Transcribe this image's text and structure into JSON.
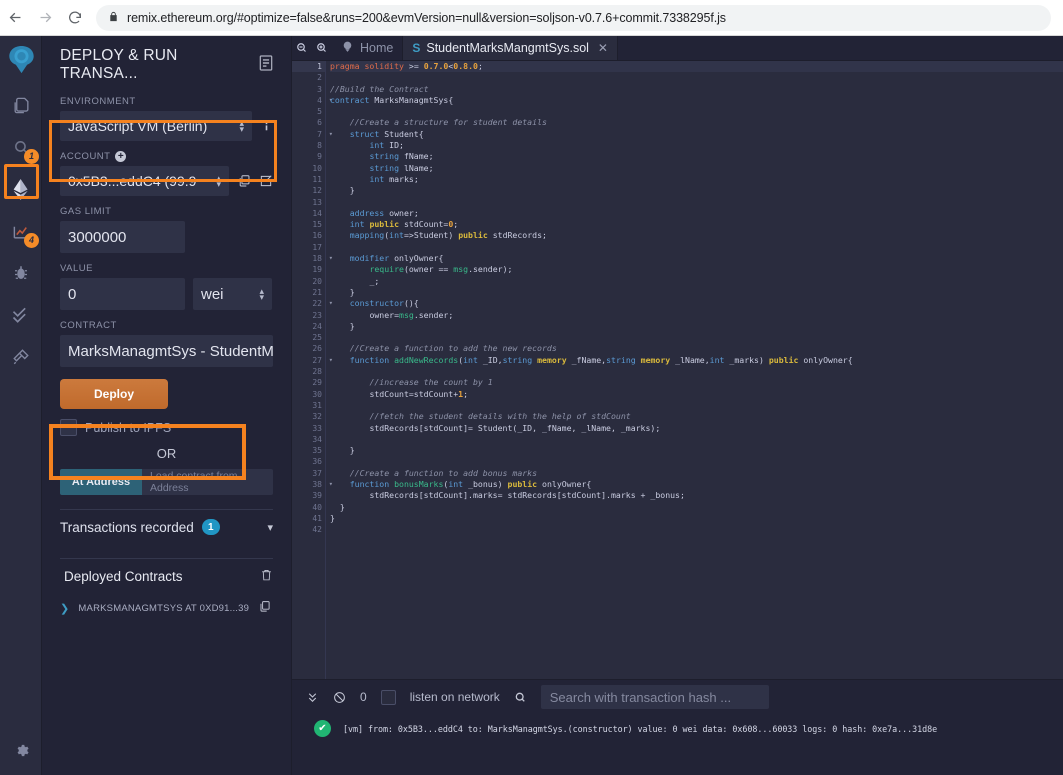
{
  "browser": {
    "back_icon": "back-arrow-icon",
    "forward_icon": "forward-arrow-icon",
    "reload_icon": "reload-icon",
    "lock_icon": "lock-icon",
    "url": "remix.ethereum.org/#optimize=false&runs=200&evmVersion=null&version=soljson-v0.7.6+commit.7338295f.js"
  },
  "icon_rail": {
    "items": [
      {
        "name": "remix-logo-icon",
        "badge": null,
        "active": false
      },
      {
        "name": "file-explorer-icon",
        "badge": null,
        "active": false
      },
      {
        "name": "search-icon",
        "badge": "1",
        "active": false
      },
      {
        "name": "deploy-run-icon",
        "badge": null,
        "active": true
      },
      {
        "name": "solidity-compiler-icon",
        "badge": "4",
        "active": false
      },
      {
        "name": "debugger-icon",
        "badge": null,
        "active": false
      },
      {
        "name": "analysis-icon",
        "badge": null,
        "active": false
      },
      {
        "name": "plugin-manager-icon",
        "badge": null,
        "active": false
      }
    ],
    "settings_icon": "gear-icon"
  },
  "panel": {
    "title": "DEPLOY & RUN TRANSA...",
    "header_icon": "document-icon",
    "environment": {
      "label": "ENVIRONMENT",
      "value": "JavaScript VM (Berlin)",
      "info_icon": "info-icon",
      "highlighted": true
    },
    "account": {
      "label": "ACCOUNT",
      "plus_icon": "plus-circle-icon",
      "value": "0x5B3...eddC4 (99.9",
      "copy_icon": "copy-icon",
      "edit_icon": "edit-icon"
    },
    "gas_limit": {
      "label": "GAS LIMIT",
      "value": "3000000"
    },
    "value": {
      "label": "VALUE",
      "amount": "0",
      "unit": "wei"
    },
    "contract": {
      "label": "CONTRACT",
      "value": "MarksManagmtSys - StudentM"
    },
    "deploy_button": {
      "label": "Deploy",
      "highlighted": true
    },
    "publish_ipfs": {
      "label": "Publish to IPFS",
      "checked": false
    },
    "or_text": "OR",
    "at_address": {
      "button_label": "At Address",
      "input_placeholder": "Load contract from Address"
    },
    "transactions_recorded": {
      "label": "Transactions recorded",
      "count": "1",
      "chevron_icon": "chevron-down-icon"
    },
    "deployed_contracts": {
      "label": "Deployed Contracts",
      "trash_icon": "trash-icon",
      "items": [
        {
          "caret_icon": "caret-right-icon",
          "label": "MARKSMANAGMTSYS AT 0XD91...39",
          "copy_icon": "copy-icon",
          "close_icon": "close-icon"
        }
      ]
    }
  },
  "editor": {
    "zoom_out_icon": "zoom-out-icon",
    "zoom_in_icon": "zoom-in-icon",
    "tabs": [
      {
        "label": "Home",
        "icon": "home-icon",
        "active": false,
        "closable": false
      },
      {
        "label": "StudentMarksMangmtSys.sol",
        "icon": "solidity-icon",
        "active": true,
        "closable": true
      }
    ],
    "code_lines": [
      {
        "n": 1,
        "fold": false,
        "current": true,
        "html": "<span class='pg'>pragma solidity</span> <span class='pl'>&gt;=</span> <span class='nm'>0.7.0</span><span class='pl'>&lt;</span><span class='nm'>0.8.0</span><span class='pl'>;</span>"
      },
      {
        "n": 2,
        "fold": false,
        "current": false,
        "html": ""
      },
      {
        "n": 3,
        "fold": false,
        "current": false,
        "html": "<span class='cm'>//Build the Contract</span>"
      },
      {
        "n": 4,
        "fold": true,
        "current": false,
        "html": "<span class='k'>contract</span> <span class='pl'>MarksManagmtSys{</span>"
      },
      {
        "n": 5,
        "fold": false,
        "current": false,
        "html": ""
      },
      {
        "n": 6,
        "fold": false,
        "current": false,
        "html": "    <span class='cm'>//Create a structure for student details</span>"
      },
      {
        "n": 7,
        "fold": true,
        "current": false,
        "html": "    <span class='k'>struct</span> <span class='pl'>Student{</span>"
      },
      {
        "n": 8,
        "fold": false,
        "current": false,
        "html": "        <span class='ty'>int</span> <span class='pl'>ID;</span>"
      },
      {
        "n": 9,
        "fold": false,
        "current": false,
        "html": "        <span class='ty'>string</span> <span class='pl'>fName;</span>"
      },
      {
        "n": 10,
        "fold": false,
        "current": false,
        "html": "        <span class='ty'>string</span> <span class='pl'>lName;</span>"
      },
      {
        "n": 11,
        "fold": false,
        "current": false,
        "html": "        <span class='ty'>int</span> <span class='pl'>marks;</span>"
      },
      {
        "n": 12,
        "fold": false,
        "current": false,
        "html": "    <span class='pl'>}</span>"
      },
      {
        "n": 13,
        "fold": false,
        "current": false,
        "html": ""
      },
      {
        "n": 14,
        "fold": false,
        "current": false,
        "html": "    <span class='ty'>address</span> <span class='pl'>owner;</span>"
      },
      {
        "n": 15,
        "fold": false,
        "current": false,
        "html": "    <span class='ty'>int</span> <span class='pr'>public</span> <span class='pl'>stdCount=</span><span class='nm'>0</span><span class='pl'>;</span>"
      },
      {
        "n": 16,
        "fold": false,
        "current": false,
        "html": "    <span class='k'>mapping</span><span class='pl'>(</span><span class='ty'>int</span><span class='pl'>=&gt;Student)</span> <span class='pr'>public</span> <span class='pl'>stdRecords;</span>"
      },
      {
        "n": 17,
        "fold": false,
        "current": false,
        "html": ""
      },
      {
        "n": 18,
        "fold": true,
        "current": false,
        "html": "    <span class='k'>modifier</span> <span class='pl'>onlyOwner{</span>"
      },
      {
        "n": 19,
        "fold": false,
        "current": false,
        "html": "        <span class='fn'>require</span><span class='pl'>(owner ==</span> <span class='fn'>msg</span><span class='pl'>.sender);</span>"
      },
      {
        "n": 20,
        "fold": false,
        "current": false,
        "html": "        <span class='pl'>_;</span>"
      },
      {
        "n": 21,
        "fold": false,
        "current": false,
        "html": "    <span class='pl'>}</span>"
      },
      {
        "n": 22,
        "fold": true,
        "current": false,
        "html": "    <span class='k'>constructor</span><span class='pl'>(){</span>"
      },
      {
        "n": 23,
        "fold": false,
        "current": false,
        "html": "        <span class='pl'>owner=</span><span class='fn'>msg</span><span class='pl'>.sender;</span>"
      },
      {
        "n": 24,
        "fold": false,
        "current": false,
        "html": "    <span class='pl'>}</span>"
      },
      {
        "n": 25,
        "fold": false,
        "current": false,
        "html": ""
      },
      {
        "n": 26,
        "fold": false,
        "current": false,
        "html": "    <span class='cm'>//Create a function to add the new records</span>"
      },
      {
        "n": 27,
        "fold": true,
        "current": false,
        "html": "    <span class='k'>function</span> <span class='fn'>addNewRecords</span><span class='pl'>(</span><span class='ty'>int</span> <span class='pl'>_ID,</span><span class='ty'>string</span> <span class='pr'>memory</span> <span class='pl'>_fName,</span><span class='ty'>string</span> <span class='pr'>memory</span> <span class='pl'>_lName,</span><span class='ty'>int</span> <span class='pl'>_marks)</span> <span class='pr'>public</span> <span class='pl'>onlyOwner{</span>"
      },
      {
        "n": 28,
        "fold": false,
        "current": false,
        "html": ""
      },
      {
        "n": 29,
        "fold": false,
        "current": false,
        "html": "        <span class='cm'>//increase the count by 1</span>"
      },
      {
        "n": 30,
        "fold": false,
        "current": false,
        "html": "        <span class='pl'>stdCount=stdCount+</span><span class='nm'>1</span><span class='pl'>;</span>"
      },
      {
        "n": 31,
        "fold": false,
        "current": false,
        "html": ""
      },
      {
        "n": 32,
        "fold": false,
        "current": false,
        "html": "        <span class='cm'>//fetch the student details with the help of stdCount</span>"
      },
      {
        "n": 33,
        "fold": false,
        "current": false,
        "html": "        <span class='pl'>stdRecords[stdCount]= Student(_ID, _fName, _lName, _marks);</span>"
      },
      {
        "n": 34,
        "fold": false,
        "current": false,
        "html": ""
      },
      {
        "n": 35,
        "fold": false,
        "current": false,
        "html": "    <span class='pl'>}</span>"
      },
      {
        "n": 36,
        "fold": false,
        "current": false,
        "html": ""
      },
      {
        "n": 37,
        "fold": false,
        "current": false,
        "html": "    <span class='cm'>//Create a function to add bonus marks</span>"
      },
      {
        "n": 38,
        "fold": true,
        "current": false,
        "html": "    <span class='k'>function</span> <span class='fn'>bonusMarks</span><span class='pl'>(</span><span class='ty'>int</span> <span class='pl'>_bonus)</span> <span class='pr'>public</span> <span class='pl'>onlyOwner{</span>"
      },
      {
        "n": 39,
        "fold": false,
        "current": false,
        "html": "        <span class='pl'>stdRecords[stdCount].marks= stdRecords[stdCount].marks + _bonus;</span>"
      },
      {
        "n": 40,
        "fold": false,
        "current": false,
        "html": "  <span class='pl'>}</span>"
      },
      {
        "n": 41,
        "fold": false,
        "current": false,
        "html": "<span class='pl'>}</span>"
      },
      {
        "n": 42,
        "fold": false,
        "current": false,
        "html": ""
      }
    ]
  },
  "terminal": {
    "collapse_icon": "chevrons-down-icon",
    "clear_icon": "ban-icon",
    "pending_count": "0",
    "listen_label": "listen on network",
    "listen_checked": false,
    "search_icon": "search-icon",
    "search_placeholder": "Search with transaction hash ...",
    "log": {
      "status_icon": "check-circle-icon",
      "text": "[vm] from: 0x5B3...eddC4 to: MarksManagmtSys.(constructor) value: 0 wei data: 0x608...60033 logs: 0 hash: 0xe7a...31d8e"
    }
  },
  "colors": {
    "accent_orange": "#f5821f",
    "panel_bg": "#222336",
    "editor_bg": "#2a2c3e",
    "deploy_btn": "#c87137",
    "badge_blue": "#2196c4",
    "success_green": "#21b573"
  }
}
